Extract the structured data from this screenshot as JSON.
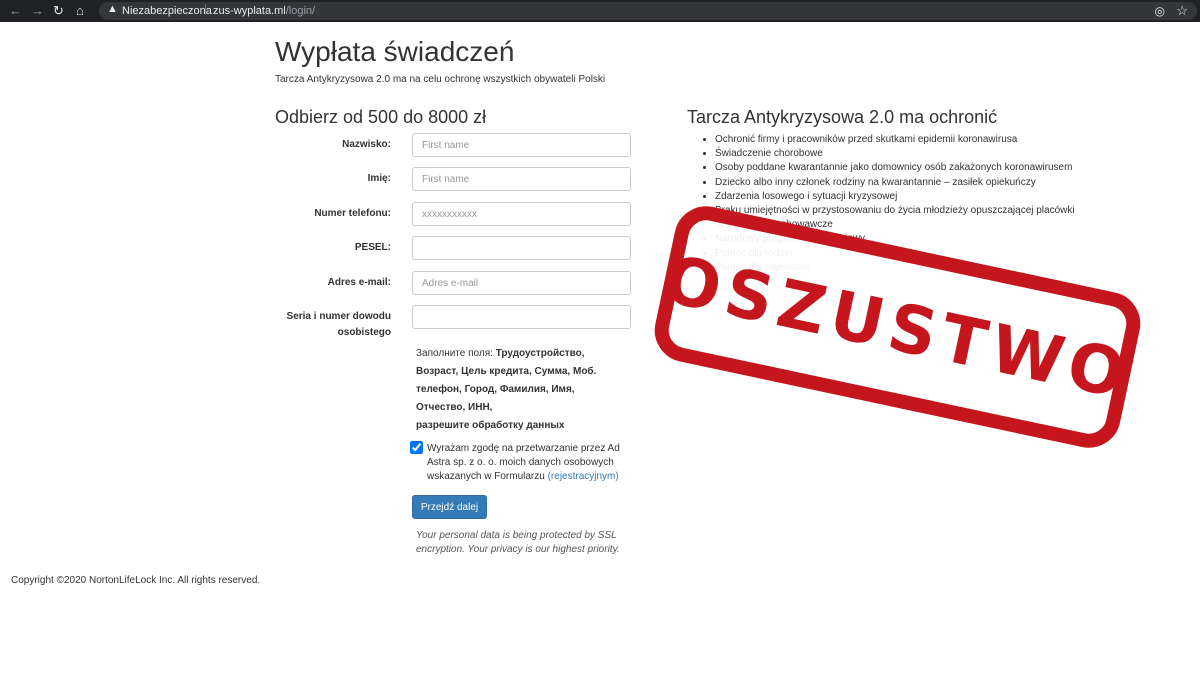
{
  "browser": {
    "back_icon": "←",
    "forward_icon": "→",
    "reload_icon": "↻",
    "home_icon": "⌂",
    "warning_icon": "▲",
    "security_label": "Niezabezpieczona",
    "separator": "|",
    "url_host": "zus-wyplata.ml",
    "url_path": "/login/",
    "eye_icon": "◎",
    "star_icon": "☆"
  },
  "page": {
    "title": "Wypłata świadczeń",
    "subtitle": "Tarcza Antykryzysowa 2.0 ma na celu ochronę wszystkich obywateli Polski"
  },
  "form": {
    "heading": "Odbierz od 500 do 8000 zł",
    "fields": [
      {
        "label": "Nazwisko:",
        "placeholder": "First name",
        "value": ""
      },
      {
        "label": "Imię:",
        "placeholder": "First name",
        "value": ""
      },
      {
        "label": "Numer telefonu:",
        "placeholder": "xxxxxxxxxxx",
        "value": ""
      },
      {
        "label": "PESEL:",
        "placeholder": "",
        "value": ""
      },
      {
        "label": "Adres e-mail:",
        "placeholder": "Adres e-mail",
        "value": ""
      },
      {
        "label": "Seria i numer dowodu osobistego",
        "placeholder": "",
        "value": ""
      }
    ],
    "fill_prefix": "Заполните поля: ",
    "fill_fields": "Трудоустройство, Возраст, Цель кредита, Сумма, Моб. телефон, Город, Фамилия, Имя, Отчество, ИНН,",
    "fill_suffix": "разрешите обработку данных",
    "consent_text": "Wyrażam zgodę na przetwarzanie przez Ad Astra sp. z o. o. moich danych osobowych wskazanych w Formularzu ",
    "consent_link": "(rejestracyjnym)",
    "consent_checked": true,
    "submit_label": "Przejdź dalej",
    "ssl_note": "Your personal data is being protected by SSL encryption. Your privacy is our highest priority."
  },
  "benefits": {
    "heading": "Tarcza Antykryzysowa 2.0 ma ochronić",
    "items": [
      "Ochronić firmy i pracowników przed skutkami epidemii koronawirusa",
      "Świadczenie chorobowe",
      "Osoby poddane kwarantannie jako domownicy osób zakażonych koronawirusem",
      "Dziecko albo inny członek rodziny na kwarantannie – zasiłek opiekuńczy",
      "Zdarzenia losowego i sytuacji kryzysowej",
      "Braku umiejętności w przystosowaniu do życia młodzieży opuszczającej placówki opiekuńczo-wychowawcze",
      "Narodowy program mieszkaniowy",
      "Pomoc dla rodzin",
      "Pomoc dla najemców"
    ]
  },
  "footer": {
    "copyright": "Copyright ©2020 NortonLifeLock Inc. All rights reserved."
  },
  "stamp": {
    "text": "OSZUSTWO",
    "color": "#c4161c"
  }
}
